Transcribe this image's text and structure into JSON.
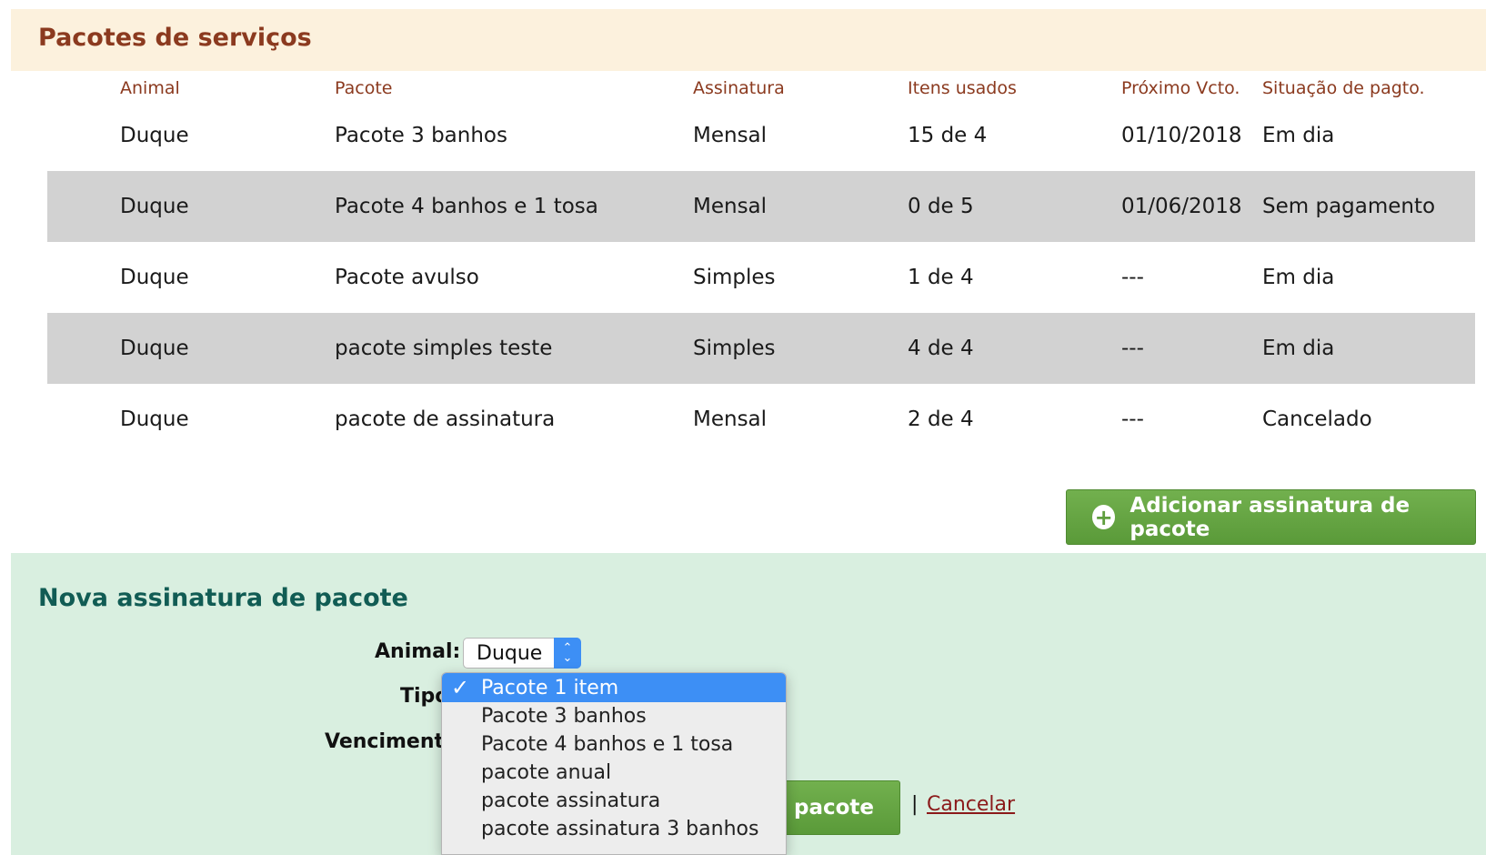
{
  "services": {
    "title": "Pacotes de serviços",
    "columns": [
      "Animal",
      "Pacote",
      "Assinatura",
      "Itens usados",
      "Próximo Vcto.",
      "Situação de pagto."
    ],
    "rows": [
      {
        "animal": "Duque",
        "pacote": "Pacote 3 banhos",
        "assinatura": "Mensal",
        "itens": "15 de 4",
        "vencimento": "01/10/2018",
        "situacao": "Em dia"
      },
      {
        "animal": "Duque",
        "pacote": "Pacote 4 banhos e 1 tosa",
        "assinatura": "Mensal",
        "itens": "0 de 5",
        "vencimento": "01/06/2018",
        "situacao": "Sem pagamento"
      },
      {
        "animal": "Duque",
        "pacote": "Pacote avulso",
        "assinatura": "Simples",
        "itens": "1 de 4",
        "vencimento": "---",
        "situacao": "Em dia"
      },
      {
        "animal": "Duque",
        "pacote": "pacote simples teste",
        "assinatura": "Simples",
        "itens": "4 de 4",
        "vencimento": "---",
        "situacao": "Em dia"
      },
      {
        "animal": "Duque",
        "pacote": "pacote de assinatura",
        "assinatura": "Mensal",
        "itens": "2 de 4",
        "vencimento": "---",
        "situacao": "Cancelado"
      }
    ],
    "add_button_label": "Adicionar assinatura de pacote"
  },
  "new_subscription": {
    "title": "Nova assinatura de pacote",
    "animal_label": "Animal:",
    "animal_value": "Duque",
    "tipo_label": "Tipo",
    "vencimento_label": "Vencimento",
    "save_button_label": "e pacote",
    "separator": "|",
    "cancel_label": "Cancelar",
    "tipo_options": [
      "Pacote 1 item",
      "Pacote 3 banhos",
      "Pacote 4 banhos e 1 tosa",
      "pacote anual",
      "pacote assinatura",
      "pacote assinatura 3 banhos"
    ],
    "tipo_selected": "Pacote 1 item"
  },
  "colors": {
    "header_bg": "#fcf1dd",
    "header_text": "#8b3a1f",
    "row_shade": "#d2d2d2",
    "button_green": "#5f9e3e",
    "form_bg": "#d9efe0",
    "form_title": "#115c54",
    "select_blue": "#3d8ff5",
    "link_red": "#8b1a1a"
  },
  "icons": {
    "add_button": "plus-circle-icon",
    "selected_option": "checkmark-icon",
    "select_arrows": "updown-chevron-icon"
  }
}
